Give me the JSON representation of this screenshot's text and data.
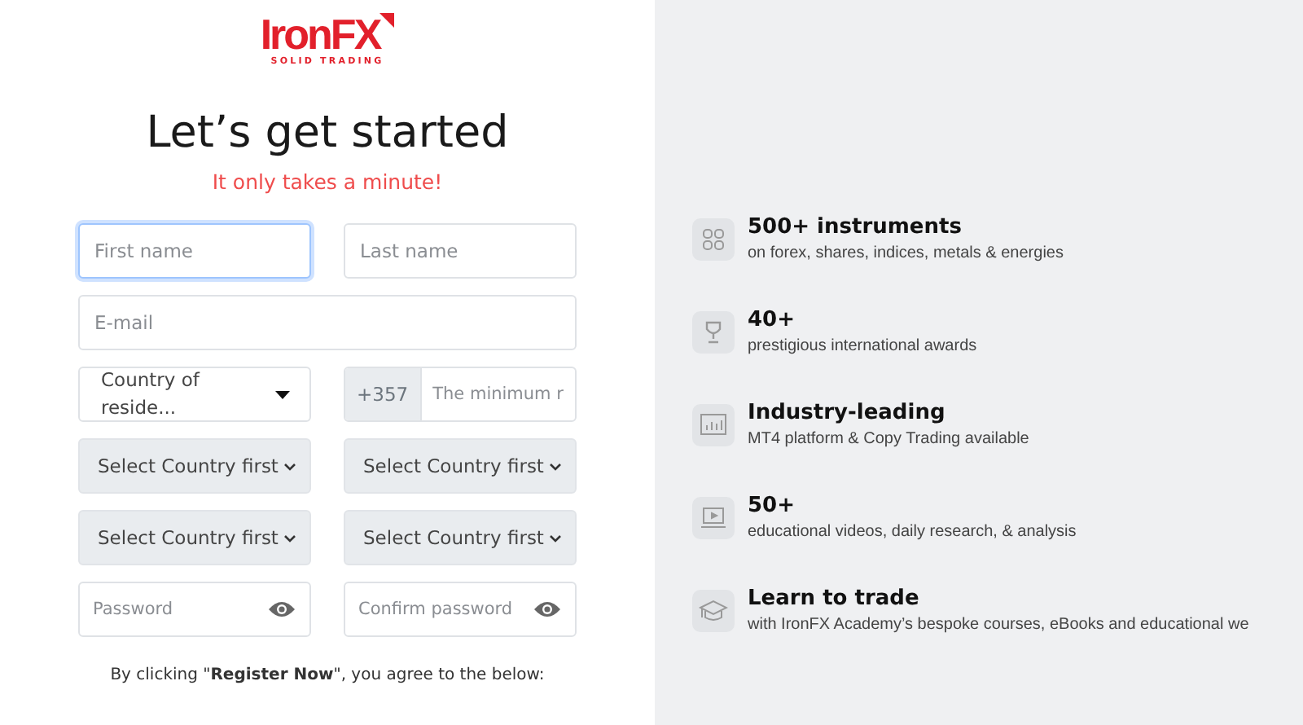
{
  "logo": {
    "name": "IronFX",
    "tagline": "SOLID TRADING"
  },
  "heading": "Let’s get started",
  "subheading": "It only takes a minute!",
  "form": {
    "rows": [
      [
        {
          "kind": "text",
          "placeholder": "First name",
          "focused": true
        },
        {
          "kind": "text",
          "placeholder": "Last name",
          "focused": false
        }
      ],
      [
        {
          "kind": "text",
          "placeholder": "E-mail",
          "focused": false
        }
      ],
      [
        {
          "kind": "dropdown",
          "value": "Country of reside..."
        },
        {
          "kind": "phone",
          "prefix": "+357",
          "placeholder": "The minimum r"
        }
      ],
      [
        {
          "kind": "select",
          "value": "Select Country first"
        },
        {
          "kind": "select",
          "value": "Select Country first"
        }
      ],
      [
        {
          "kind": "select",
          "value": "Select Country first"
        },
        {
          "kind": "select",
          "value": "Select Country first"
        }
      ],
      [
        {
          "kind": "password",
          "placeholder": "Password"
        },
        {
          "kind": "password",
          "placeholder": "Confirm password"
        }
      ]
    ]
  },
  "consent": "By clicking \"**Register Now**\", you agree to the below:",
  "features": [
    {
      "title": "500+ instruments",
      "text": "on forex, shares, indices, metals & energies"
    },
    {
      "title": "40+",
      "text": "prestigious international awards"
    },
    {
      "title": "Industry-leading",
      "text": "MT4 platform & Copy Trading available"
    },
    {
      "title": "50+",
      "text": "educational videos, daily research, & analysis"
    },
    {
      "title": "Learn to trade",
      "text": "with IronFX Academy’s bespoke courses, eBooks and educational we"
    }
  ]
}
